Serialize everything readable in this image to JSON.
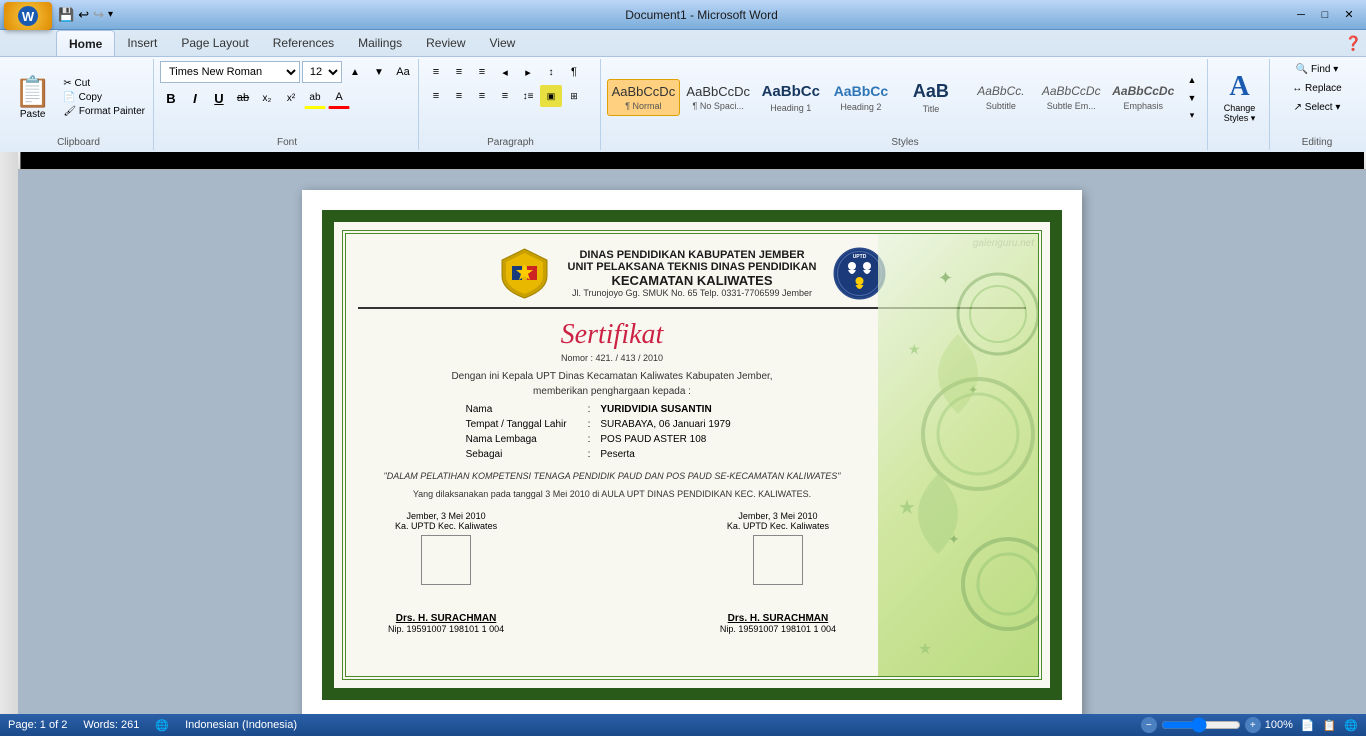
{
  "titlebar": {
    "title": "Document1 - Microsoft Word",
    "minimize": "─",
    "maximize": "□",
    "close": "✕"
  },
  "quickaccess": {
    "save": "💾",
    "undo": "↩",
    "redo": "↪",
    "dropdown": "▾"
  },
  "ribbon": {
    "tabs": [
      "Home",
      "Insert",
      "Page Layout",
      "References",
      "Mailings",
      "Review",
      "View"
    ],
    "active_tab": "Home",
    "groups": {
      "clipboard": {
        "label": "Clipboard",
        "paste": "Paste",
        "cut": "Cut",
        "copy": "Copy",
        "format_painter": "Format Painter"
      },
      "font": {
        "label": "Font",
        "name": "Times New Roman",
        "size": "12",
        "size_up": "▲",
        "size_down": "▼",
        "clear": "Aa",
        "bold": "B",
        "italic": "I",
        "underline": "U",
        "strikethrough": "ab",
        "subscript": "x₂",
        "superscript": "x²",
        "highlight": "ab",
        "color": "A"
      },
      "paragraph": {
        "label": "Paragraph",
        "bullets": "≡",
        "numbering": "≡",
        "multilevel": "≡",
        "decrease": "◂",
        "increase": "▸",
        "sort": "↕",
        "show_hide": "¶"
      },
      "styles": {
        "label": "Styles",
        "items": [
          {
            "id": "normal",
            "preview": "AaBbCcDc",
            "label": "¶ Normal",
            "active": true
          },
          {
            "id": "no-spacing",
            "preview": "AaBbCcDc",
            "label": "¶ No Spaci..."
          },
          {
            "id": "heading1",
            "preview": "AaBbCc",
            "label": "Heading 1"
          },
          {
            "id": "heading2",
            "preview": "AaBbCc",
            "label": "Heading 2"
          },
          {
            "id": "title",
            "preview": "AaB",
            "label": "Title"
          },
          {
            "id": "subtitle",
            "preview": "AaBbCc.",
            "label": "Subtitle"
          },
          {
            "id": "subtle-em",
            "preview": "AaBbCcDc",
            "label": "Subtle Em..."
          },
          {
            "id": "emphasis",
            "preview": "AaBbCcDc",
            "label": "Emphasis"
          }
        ],
        "scroll_up": "▲",
        "scroll_down": "▼",
        "more": "▾"
      },
      "change_styles": {
        "label": "Change Styles",
        "icon": "A"
      },
      "editing": {
        "label": "Editing",
        "find": "Find ▾",
        "replace": "Replace",
        "select": "Select ▾"
      }
    }
  },
  "document": {
    "cert": {
      "watermark": "galeriguru.net",
      "header": {
        "line1": "DINAS PENDIDIKAN KABUPATEN JEMBER",
        "line2": "UNIT PELAKSANA TEKNIS DINAS PENDIDIKAN",
        "line3": "KECAMATAN KALIWATES",
        "line4": "Jl. Trunojoyo Gg. SMUK No. 65 Telp. 0331-7706599 Jember"
      },
      "main_title": "Sertifikat",
      "nomor": "Nomor : 421. / 413 / 2010",
      "text1": "Dengan ini Kepala UPT Dinas Kecamatan Kaliwates Kabupaten Jember,",
      "text2": "memberikan penghargaan kepada :",
      "fields": [
        {
          "label": "Nama",
          "sep": ":",
          "value": "YURIDVIDIA SUSANTIN"
        },
        {
          "label": "Tempat / Tanggal Lahir",
          "sep": ":",
          "value": "SURABAYA, 06 Januari 1979"
        },
        {
          "label": "Nama Lembaga",
          "sep": ":",
          "value": "POS PAUD ASTER 108"
        },
        {
          "label": "Sebagai",
          "sep": ":",
          "value": "Peserta"
        }
      ],
      "statement": "\"DALAM PELATIHAN KOMPETENSI TENAGA PENDIDIK PAUD DAN POS PAUD SE-KECAMATAN KALIWATES\"",
      "statement2": "Yang dilaksanakan pada tanggal 3 Mei 2010 di AULA UPT DINAS PENDIDIKAN KEC. KALIWATES.",
      "sig_left": {
        "city_date": "Jember, 3 Mei 2010",
        "title": "Ka. UPTD Kec. Kaliwates",
        "name": "Drs. H. SURACHMAN",
        "nip": "Nip. 19591007 198101 1 004"
      },
      "sig_right": {
        "city_date": "Jember, 3 Mei 2010",
        "title": "Ka. UPTD Kec. Kaliwates",
        "name": "Drs. H. SURACHMAN",
        "nip": "Nip. 19591007 198101 1 004"
      }
    }
  },
  "statusbar": {
    "page": "Page: 1 of 2",
    "words": "Words: 261",
    "language": "Indonesian (Indonesia)",
    "zoom": "100%"
  }
}
